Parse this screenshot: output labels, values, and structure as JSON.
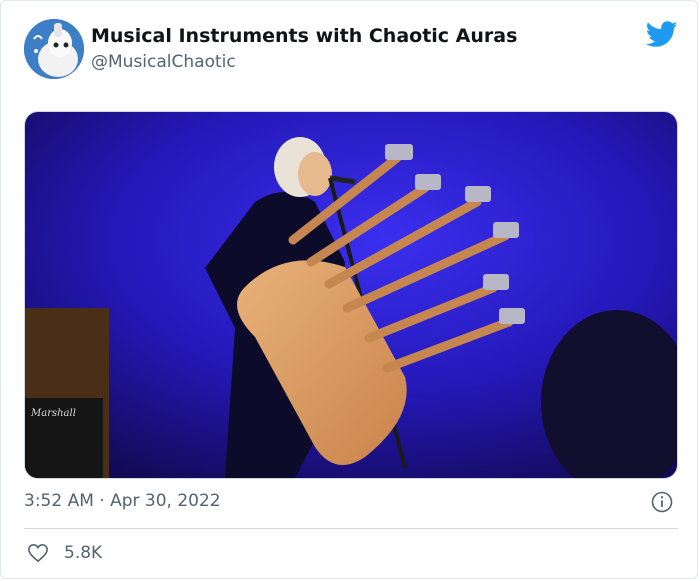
{
  "tweet": {
    "display_name": "Musical Instruments with Chaotic Auras",
    "handle": "@MusicalChaotic",
    "timestamp": "3:52 AM · Apr 30, 2022",
    "likes": "5.8K"
  },
  "media": {
    "amp_brand": "Marshall"
  },
  "colors": {
    "brand": "#1d9bf0",
    "secondary_text": "#536471",
    "stage_light": "#2a1fd6"
  },
  "icons": {
    "avatar": "cartoon-character-avatar",
    "logo": "twitter-bird-icon",
    "info": "info-circle-icon",
    "like": "heart-outline-icon"
  }
}
